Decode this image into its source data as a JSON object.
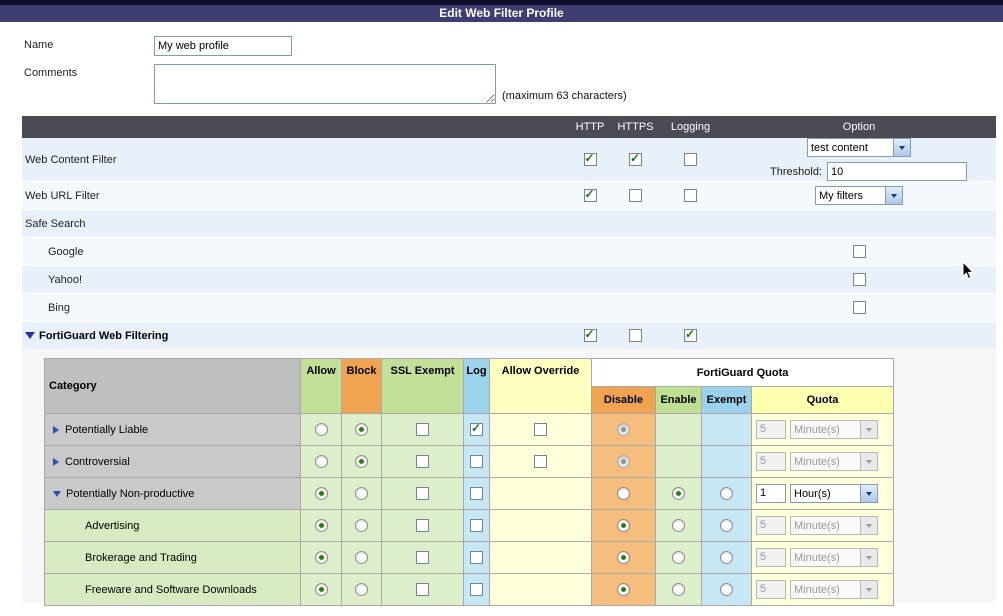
{
  "title_bar": {
    "title": "Edit Web Filter Profile"
  },
  "form": {
    "name": {
      "label": "Name",
      "value": "My web profile"
    },
    "comments": {
      "label": "Comments",
      "value": "",
      "hint": "(maximum 63 characters)"
    }
  },
  "filter_table": {
    "columns": {
      "http": "HTTP",
      "https": "HTTPS",
      "logging": "Logging",
      "option": "Option"
    },
    "rows": {
      "web_content_filter": {
        "label": "Web Content Filter",
        "http": true,
        "https": true,
        "logging": false,
        "option_select": "test content",
        "threshold_label": "Threshold:",
        "threshold_value": "10"
      },
      "web_url_filter": {
        "label": "Web URL Filter",
        "http": true,
        "https": false,
        "logging": false,
        "option_select": "My filters"
      },
      "safe_search": {
        "label": "Safe Search"
      },
      "google": {
        "label": "Google",
        "enabled": false
      },
      "yahoo": {
        "label": "Yahoo!",
        "enabled": false
      },
      "bing": {
        "label": "Bing",
        "enabled": false
      },
      "fortiguard": {
        "label": "FortiGuard Web Filtering",
        "http": true,
        "https": false,
        "logging": true
      }
    }
  },
  "category_table": {
    "headers": {
      "category": "Category",
      "allow": "Allow",
      "block": "Block",
      "ssl_exempt": "SSL Exempt",
      "log": "Log",
      "allow_override": "Allow Override",
      "fortiguard_quota": "FortiGuard Quota",
      "disable": "Disable",
      "enable": "Enable",
      "exempt": "Exempt",
      "quota": "Quota"
    },
    "rows": [
      {
        "label": "Potentially Liable",
        "expanded": false,
        "allow": false,
        "block": true,
        "ssl_exempt": false,
        "log": true,
        "allow_override": false,
        "quota": {
          "disable": true,
          "locked": true,
          "value": "5",
          "unit": "Minute(s)"
        }
      },
      {
        "label": "Controversial",
        "expanded": false,
        "allow": false,
        "block": true,
        "ssl_exempt": false,
        "log": false,
        "allow_override": false,
        "quota": {
          "disable": true,
          "locked": true,
          "value": "5",
          "unit": "Minute(s)"
        }
      },
      {
        "label": "Potentially Non-productive",
        "expanded": true,
        "allow": true,
        "block": false,
        "ssl_exempt": false,
        "log": false,
        "quota": {
          "disable": false,
          "enable": true,
          "exempt": false,
          "value": "1",
          "unit": "Hour(s)",
          "controls_disabled": false
        }
      },
      {
        "label": "Advertising",
        "sub": true,
        "allow": true,
        "block": false,
        "ssl_exempt": false,
        "log": false,
        "quota": {
          "disable": true,
          "enable": false,
          "exempt": false,
          "value": "5",
          "unit": "Minute(s)",
          "controls_disabled": true
        }
      },
      {
        "label": "Brokerage and Trading",
        "sub": true,
        "allow": true,
        "block": false,
        "ssl_exempt": false,
        "log": false,
        "quota": {
          "disable": true,
          "enable": false,
          "exempt": false,
          "value": "5",
          "unit": "Minute(s)",
          "controls_disabled": true
        }
      },
      {
        "label": "Freeware and Software Downloads",
        "sub": true,
        "allow": true,
        "block": false,
        "ssl_exempt": false,
        "log": false,
        "quota": {
          "disable": true,
          "enable": false,
          "exempt": false,
          "value": "5",
          "unit": "Minute(s)",
          "controls_disabled": true
        }
      }
    ]
  },
  "icons": {
    "collapsed_arrow": "▶",
    "expanded_arrow": "▼",
    "select_arrow": "▾"
  },
  "colors": {
    "title_bar": "#3e3e72",
    "table_header": "#4b4b55",
    "row_blue": "#e8f1f9",
    "allow_green_header": "#c3e098",
    "block_orange_header": "#f0a452",
    "log_blue_header": "#9bd3ec",
    "override_yellow_header": "#ffffc0",
    "check_green": "#157a15"
  }
}
